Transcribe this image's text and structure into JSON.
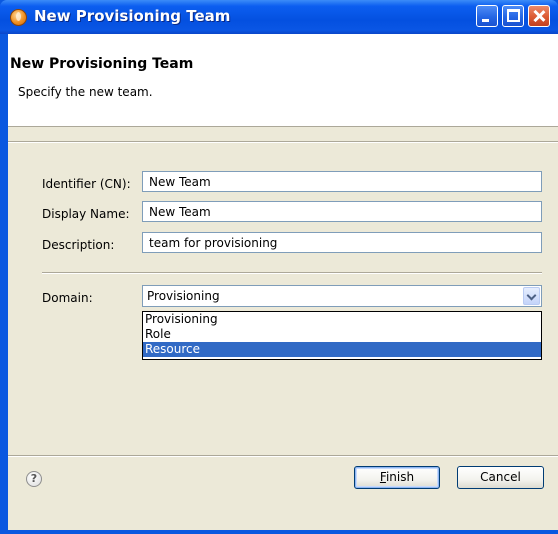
{
  "window": {
    "title": "New Provisioning Team"
  },
  "banner": {
    "title": "New Provisioning Team",
    "description": "Specify the new team."
  },
  "form": {
    "identifier": {
      "label": "Identifier (CN):",
      "value": "New Team"
    },
    "display_name": {
      "label": "Display Name:",
      "value": "New Team"
    },
    "description": {
      "label": "Description:",
      "value": "team for provisioning"
    },
    "domain": {
      "label": "Domain:",
      "value": "Provisioning",
      "options": [
        "Provisioning",
        "Role",
        "Resource"
      ],
      "highlighted": "Resource"
    }
  },
  "buttons": {
    "finish_mnemonic": "F",
    "finish_rest": "inish",
    "cancel": "Cancel"
  },
  "help": {
    "glyph": "?"
  },
  "colors": {
    "titlebar": "#0a58e0",
    "dialog_bg": "#ece9d8",
    "selection": "#316ac5"
  }
}
